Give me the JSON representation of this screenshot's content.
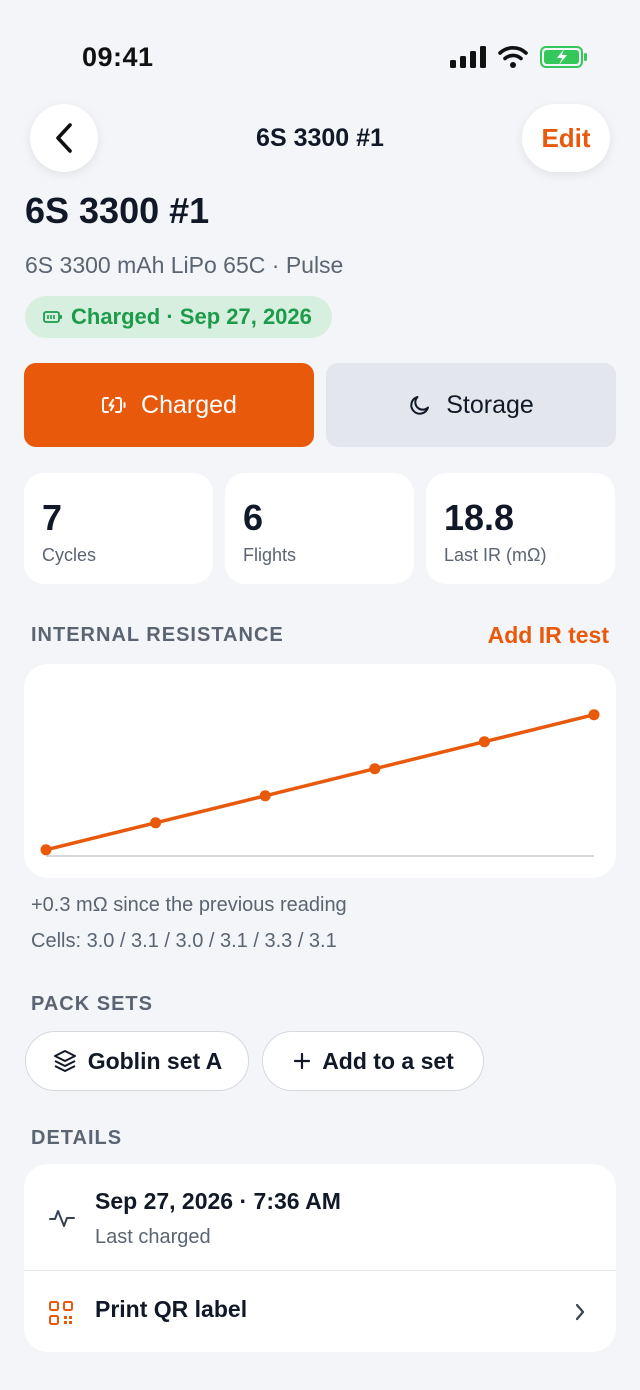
{
  "status_bar": {
    "time": "09:41"
  },
  "nav": {
    "title": "6S 3300 #1",
    "edit_label": "Edit"
  },
  "battery": {
    "name": "6S 3300 #1",
    "description": "6S 3300 mAh LiPo 65C · Pulse",
    "status_badge": "Charged · Sep 27, 2026"
  },
  "modes": {
    "charged_label": "Charged",
    "storage_label": "Storage",
    "selected": "charged"
  },
  "stats": [
    {
      "value": "7",
      "label": "Cycles"
    },
    {
      "value": "6",
      "label": "Flights"
    },
    {
      "value": "18.8",
      "label": "Last IR (mΩ)"
    }
  ],
  "ir_section": {
    "header": "INTERNAL RESISTANCE",
    "action": "Add IR test",
    "delta_note": "+0.3 mΩ since the previous reading",
    "cells_note": "Cells: 3.0 / 3.1 / 3.0 / 3.1 / 3.3 / 3.1"
  },
  "chart_data": {
    "type": "line",
    "x": [
      1,
      2,
      3,
      4,
      5,
      6
    ],
    "series": [
      {
        "values": [
          17.6,
          17.84,
          18.08,
          18.32,
          18.56,
          18.8
        ]
      }
    ],
    "ylim": [
      17.35,
      19.25
    ],
    "grid": false,
    "title": "",
    "xlabel": "",
    "ylabel": "",
    "color": "#e8590c"
  },
  "pack_sets": {
    "header": "PACK SETS",
    "items": [
      {
        "label": "Goblin set A"
      }
    ],
    "add_label": "Add to a set"
  },
  "details": {
    "header": "DETAILS",
    "last_charged_value": "Sep 27, 2026 · 7:36 AM",
    "last_charged_label": "Last charged",
    "print_label": "Print QR label"
  },
  "colors": {
    "accent": "#e8590c",
    "success": "#1e9b4a",
    "background": "#f3f5f8"
  }
}
